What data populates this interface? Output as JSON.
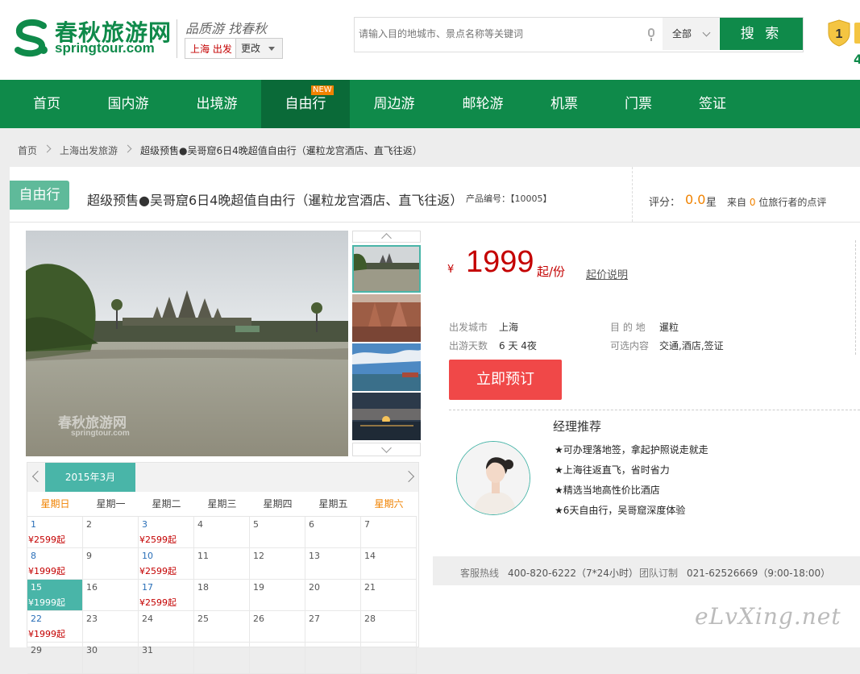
{
  "header": {
    "logo_cn": "春秋旅游网",
    "logo_en": "springtour.com",
    "slogan": "品质游 找春秋",
    "city": "上海 出发",
    "city_change": "更改",
    "search_placeholder": "请输入目的地城市、景点名称等关键词",
    "search_category": "全部",
    "search_button": "搜 索",
    "badge_digit": "1",
    "badge_number": "4"
  },
  "nav": {
    "items": [
      "首页",
      "国内游",
      "出境游",
      "自由行",
      "周边游",
      "邮轮游",
      "机票",
      "门票",
      "签证"
    ],
    "new_tag": "NEW"
  },
  "breadcrumb": [
    "首页",
    "上海出发旅游",
    "超级预售●吴哥窟6日4晚超值自由行（暹粒龙宫酒店、直飞往返）"
  ],
  "product": {
    "type_tag": "自由行",
    "title": "超级预售●吴哥窟6日4晚超值自由行（暹粒龙宫酒店、直飞往返）",
    "code": "产品编号：【10005】",
    "rating_label": "评分：",
    "rating_value": "0.0",
    "rating_unit": "星",
    "reviews_prefix": "来自",
    "reviews_count": "0",
    "reviews_suffix": "位旅行者的点评",
    "image_watermark_cn": "春秋旅游网",
    "image_watermark_en": "springtour.com"
  },
  "price": {
    "currency": "¥",
    "amount": "1999",
    "unit": "起/份",
    "note": "起价说明"
  },
  "info": {
    "depart_label": "出发城市",
    "depart_value": "上海",
    "dest_label": "目 的 地",
    "dest_value": "暹粒",
    "days_label": "出游天数",
    "days_value": "6 天 4夜",
    "options_label": "可选内容",
    "options_value": "交通,酒店,签证"
  },
  "book_button": "立即预订",
  "recommend": {
    "title": "经理推荐",
    "items": [
      "★可办理落地签，拿起护照说走就走",
      "★上海往返直飞，省时省力",
      "★精选当地高性价比酒店",
      "★6天自由行，吴哥窟深度体验"
    ]
  },
  "calendar": {
    "month": "2015年3月",
    "weekdays": [
      "星期日",
      "星期一",
      "星期二",
      "星期三",
      "星期四",
      "星期五",
      "星期六"
    ],
    "rows": [
      [
        {
          "d": "1",
          "p": "¥2599起"
        },
        {
          "d": "2",
          "p": ""
        },
        {
          "d": "3",
          "p": "¥2599起"
        },
        {
          "d": "4",
          "p": ""
        },
        {
          "d": "5",
          "p": ""
        },
        {
          "d": "6",
          "p": ""
        },
        {
          "d": "7",
          "p": ""
        }
      ],
      [
        {
          "d": "8",
          "p": "¥1999起"
        },
        {
          "d": "9",
          "p": ""
        },
        {
          "d": "10",
          "p": "¥2599起"
        },
        {
          "d": "11",
          "p": ""
        },
        {
          "d": "12",
          "p": ""
        },
        {
          "d": "13",
          "p": ""
        },
        {
          "d": "14",
          "p": ""
        }
      ],
      [
        {
          "d": "15",
          "p": "¥1999起"
        },
        {
          "d": "16",
          "p": ""
        },
        {
          "d": "17",
          "p": "¥2599起"
        },
        {
          "d": "18",
          "p": ""
        },
        {
          "d": "19",
          "p": ""
        },
        {
          "d": "20",
          "p": ""
        },
        {
          "d": "21",
          "p": ""
        }
      ],
      [
        {
          "d": "22",
          "p": "¥1999起"
        },
        {
          "d": "23",
          "p": ""
        },
        {
          "d": "24",
          "p": ""
        },
        {
          "d": "25",
          "p": ""
        },
        {
          "d": "26",
          "p": ""
        },
        {
          "d": "27",
          "p": ""
        },
        {
          "d": "28",
          "p": ""
        }
      ],
      [
        {
          "d": "29",
          "p": ""
        },
        {
          "d": "30",
          "p": ""
        },
        {
          "d": "31",
          "p": ""
        },
        {
          "d": "",
          "p": ""
        },
        {
          "d": "",
          "p": ""
        },
        {
          "d": "",
          "p": ""
        },
        {
          "d": "",
          "p": ""
        }
      ]
    ],
    "selected_date": "15"
  },
  "hotline": {
    "service_label": "客服热线",
    "service_value": "400-820-6222（7*24小时）",
    "group_label": "团队订制",
    "group_value": "021-62526669（9:00-18:00）"
  },
  "watermark": "eLvXing.net",
  "colors": {
    "brand": "#0f8a4a",
    "accent": "#49b5a8",
    "price": "#c40000",
    "book": "#f04848",
    "highlight": "#f08200"
  }
}
